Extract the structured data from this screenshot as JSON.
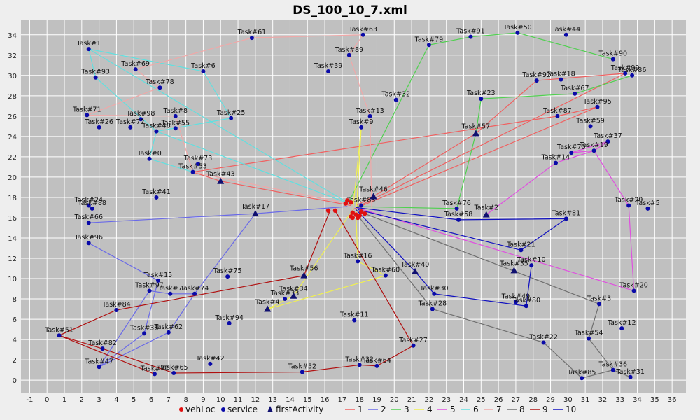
{
  "chart_data": {
    "type": "scatter",
    "title": "DS_100_10_7.xml",
    "xlabel": "",
    "ylabel": "",
    "xlim": [
      -1.5,
      36.8
    ],
    "ylim": [
      -1.3,
      35.5
    ],
    "x_ticks": [
      -1,
      0,
      1,
      2,
      3,
      4,
      5,
      6,
      7,
      8,
      9,
      10,
      11,
      12,
      13,
      14,
      15,
      16,
      17,
      18,
      19,
      20,
      21,
      22,
      23,
      24,
      25,
      26,
      27,
      28,
      29,
      30,
      31,
      32,
      33,
      34,
      35,
      36
    ],
    "y_ticks": [
      0,
      2,
      4,
      6,
      8,
      10,
      12,
      14,
      16,
      18,
      20,
      22,
      24,
      26,
      28,
      30,
      32,
      34
    ],
    "grid": true,
    "legend_position": "bottom",
    "colors": {
      "background": "#c0c0c0",
      "grid": "#ffffff",
      "vehLoc": "#e01010",
      "service": "#0a0aa8",
      "firstActivity": "#101070",
      "route_1": "#f06060",
      "route_2": "#6a6ae8",
      "route_3": "#50d050",
      "route_4": "#f0f050",
      "route_5": "#e050e0",
      "route_6": "#60e0e0",
      "route_7": "#f0a8a8",
      "route_8": "#707070",
      "route_9": "#b01010",
      "route_10": "#1010c0"
    },
    "legend": [
      {
        "label": "vehLoc",
        "kind": "dot",
        "color": "#e01010"
      },
      {
        "label": "service",
        "kind": "dot",
        "color": "#0a0aa8"
      },
      {
        "label": "firstActivity",
        "kind": "triangle",
        "color": "#101070"
      },
      {
        "label": "1",
        "kind": "line",
        "color": "#f06060"
      },
      {
        "label": "2",
        "kind": "line",
        "color": "#6a6ae8"
      },
      {
        "label": "3",
        "kind": "line",
        "color": "#50d050"
      },
      {
        "label": "4",
        "kind": "line",
        "color": "#f0f050"
      },
      {
        "label": "5",
        "kind": "line",
        "color": "#e050e0"
      },
      {
        "label": "6",
        "kind": "line",
        "color": "#60e0e0"
      },
      {
        "label": "7",
        "kind": "line",
        "color": "#f0a8a8"
      },
      {
        "label": "8",
        "kind": "line",
        "color": "#707070"
      },
      {
        "label": "9",
        "kind": "line",
        "color": "#b01010"
      },
      {
        "label": "10",
        "kind": "line",
        "color": "#1010c0"
      }
    ],
    "vehicle_locations": [
      [
        17.2,
        17.4
      ],
      [
        17.3,
        17.7
      ],
      [
        17.5,
        17.5
      ],
      [
        16.2,
        16.7
      ],
      [
        16.6,
        16.7
      ],
      [
        17.6,
        16.5
      ],
      [
        17.8,
        16.3
      ],
      [
        17.9,
        16.0
      ],
      [
        17.6,
        16.0
      ],
      [
        17.5,
        16.1
      ],
      [
        18.3,
        16.4
      ],
      [
        18.1,
        16.6
      ],
      [
        18.0,
        16.2
      ]
    ],
    "points": [
      {
        "label": "Task#1",
        "x": 2.4,
        "y": 32.6
      },
      {
        "label": "Task#93",
        "x": 2.8,
        "y": 29.8
      },
      {
        "label": "Task#69",
        "x": 5.1,
        "y": 30.6
      },
      {
        "label": "Task#6",
        "x": 9.0,
        "y": 30.4
      },
      {
        "label": "Task#78",
        "x": 6.5,
        "y": 28.8
      },
      {
        "label": "Task#71",
        "x": 2.3,
        "y": 26.1
      },
      {
        "label": "Task#98",
        "x": 5.4,
        "y": 25.7
      },
      {
        "label": "Task#8",
        "x": 7.4,
        "y": 26.0
      },
      {
        "label": "Task#25",
        "x": 10.6,
        "y": 25.8
      },
      {
        "label": "Task#26",
        "x": 3.0,
        "y": 24.9
      },
      {
        "label": "Task#72",
        "x": 4.8,
        "y": 24.9
      },
      {
        "label": "Task#48",
        "x": 6.3,
        "y": 24.5
      },
      {
        "label": "Task#55",
        "x": 7.4,
        "y": 24.8
      },
      {
        "label": "Task#0",
        "x": 5.9,
        "y": 21.8
      },
      {
        "label": "Task#73",
        "x": 8.7,
        "y": 21.3
      },
      {
        "label": "Task#53",
        "x": 8.4,
        "y": 20.5
      },
      {
        "label": "Task#41",
        "x": 6.3,
        "y": 18.0
      },
      {
        "label": "Task#24",
        "x": 2.4,
        "y": 17.2
      },
      {
        "label": "Task#88",
        "x": 2.6,
        "y": 16.9
      },
      {
        "label": "Task#66",
        "x": 2.4,
        "y": 15.5
      },
      {
        "label": "Task#96",
        "x": 2.4,
        "y": 13.5
      },
      {
        "label": "Task#15",
        "x": 6.4,
        "y": 9.8
      },
      {
        "label": "Task#97",
        "x": 5.9,
        "y": 8.8
      },
      {
        "label": "Task#7",
        "x": 7.1,
        "y": 8.5
      },
      {
        "label": "Task#74",
        "x": 8.5,
        "y": 8.5
      },
      {
        "label": "Task#75",
        "x": 10.4,
        "y": 10.2
      },
      {
        "label": "Task#84",
        "x": 4.0,
        "y": 6.9
      },
      {
        "label": "Task#38",
        "x": 5.6,
        "y": 4.6
      },
      {
        "label": "Task#62",
        "x": 7.0,
        "y": 4.7
      },
      {
        "label": "Task#94",
        "x": 10.5,
        "y": 5.6
      },
      {
        "label": "Task#51",
        "x": 0.7,
        "y": 4.4
      },
      {
        "label": "Task#82",
        "x": 3.2,
        "y": 3.1
      },
      {
        "label": "Task#47",
        "x": 3.0,
        "y": 1.3
      },
      {
        "label": "Task#42",
        "x": 9.4,
        "y": 1.6
      },
      {
        "label": "Task#77",
        "x": 6.2,
        "y": 0.6
      },
      {
        "label": "Task#65",
        "x": 7.3,
        "y": 0.7
      },
      {
        "label": "Task#61",
        "x": 11.8,
        "y": 33.7
      },
      {
        "label": "Task#63",
        "x": 18.2,
        "y": 34.0
      },
      {
        "label": "Task#89",
        "x": 17.4,
        "y": 32.0
      },
      {
        "label": "Task#39",
        "x": 16.2,
        "y": 30.4
      },
      {
        "label": "Task#32",
        "x": 20.1,
        "y": 27.6
      },
      {
        "label": "Task#13",
        "x": 18.6,
        "y": 26.0
      },
      {
        "label": "Task#9",
        "x": 18.1,
        "y": 24.9
      },
      {
        "label": "Task#83",
        "x": 18.1,
        "y": 17.2
      },
      {
        "label": "Task#16",
        "x": 17.9,
        "y": 11.7
      },
      {
        "label": "Task#60",
        "x": 19.5,
        "y": 10.3
      },
      {
        "label": "Task#11",
        "x": 17.7,
        "y": 5.9
      },
      {
        "label": "Task#33",
        "x": 13.7,
        "y": 8.0
      },
      {
        "label": "Task#52",
        "x": 14.7,
        "y": 0.8
      },
      {
        "label": "Task#32b",
        "x": 18.0,
        "y": 1.5
      },
      {
        "label": "Task#64",
        "x": 19.0,
        "y": 1.4
      },
      {
        "label": "Task#27",
        "x": 21.1,
        "y": 3.4
      },
      {
        "label": "Task#30",
        "x": 22.3,
        "y": 8.5
      },
      {
        "label": "Task#28",
        "x": 22.2,
        "y": 7.0
      },
      {
        "label": "Task#79",
        "x": 22.0,
        "y": 33.0
      },
      {
        "label": "Task#91",
        "x": 24.4,
        "y": 33.8
      },
      {
        "label": "Task#50",
        "x": 27.1,
        "y": 34.2
      },
      {
        "label": "Task#44",
        "x": 29.9,
        "y": 34.0
      },
      {
        "label": "Task#90",
        "x": 32.6,
        "y": 31.6
      },
      {
        "label": "Task#99",
        "x": 33.3,
        "y": 30.2
      },
      {
        "label": "Task#86",
        "x": 33.7,
        "y": 30.0
      },
      {
        "label": "Task#92",
        "x": 28.2,
        "y": 29.5
      },
      {
        "label": "Task#18",
        "x": 29.6,
        "y": 29.6
      },
      {
        "label": "Task#67",
        "x": 30.4,
        "y": 28.2
      },
      {
        "label": "Task#23",
        "x": 25.0,
        "y": 27.7
      },
      {
        "label": "Task#95",
        "x": 31.7,
        "y": 26.9
      },
      {
        "label": "Task#87",
        "x": 29.4,
        "y": 26.0
      },
      {
        "label": "Task#59",
        "x": 31.3,
        "y": 25.0
      },
      {
        "label": "Task#37",
        "x": 32.3,
        "y": 23.5
      },
      {
        "label": "Task#70",
        "x": 30.2,
        "y": 22.4
      },
      {
        "label": "Task#19",
        "x": 31.5,
        "y": 22.6
      },
      {
        "label": "Task#14",
        "x": 29.3,
        "y": 21.4
      },
      {
        "label": "Task#76",
        "x": 23.6,
        "y": 16.9
      },
      {
        "label": "Task#58",
        "x": 23.7,
        "y": 15.8
      },
      {
        "label": "Task#81",
        "x": 29.9,
        "y": 15.9
      },
      {
        "label": "Task#29",
        "x": 33.5,
        "y": 17.2
      },
      {
        "label": "Task#5",
        "x": 34.6,
        "y": 16.9
      },
      {
        "label": "Task#21",
        "x": 27.3,
        "y": 12.8
      },
      {
        "label": "Task#10",
        "x": 27.9,
        "y": 11.3
      },
      {
        "label": "Task#20",
        "x": 33.8,
        "y": 8.8
      },
      {
        "label": "Task#49",
        "x": 27.0,
        "y": 7.7
      },
      {
        "label": "Task#80",
        "x": 27.6,
        "y": 7.3
      },
      {
        "label": "Task#3",
        "x": 31.8,
        "y": 7.5
      },
      {
        "label": "Task#12",
        "x": 33.1,
        "y": 5.1
      },
      {
        "label": "Task#54",
        "x": 31.2,
        "y": 4.1
      },
      {
        "label": "Task#22",
        "x": 28.6,
        "y": 3.7
      },
      {
        "label": "Task#85",
        "x": 30.8,
        "y": 0.2
      },
      {
        "label": "Task#36",
        "x": 32.6,
        "y": 1.0
      },
      {
        "label": "Task#31",
        "x": 33.6,
        "y": 0.3
      }
    ],
    "first_activities": [
      {
        "label": "Task#43",
        "x": 10.0,
        "y": 19.6
      },
      {
        "label": "Task#17",
        "x": 12.0,
        "y": 16.4
      },
      {
        "label": "Task#46",
        "x": 18.8,
        "y": 18.1
      },
      {
        "label": "Task#57",
        "x": 24.7,
        "y": 24.3
      },
      {
        "label": "Task#2",
        "x": 25.3,
        "y": 16.3
      },
      {
        "label": "Task#35",
        "x": 26.9,
        "y": 10.8
      },
      {
        "label": "Task#40",
        "x": 21.2,
        "y": 10.7
      },
      {
        "label": "Task#56",
        "x": 14.8,
        "y": 10.3
      },
      {
        "label": "Task#34",
        "x": 14.2,
        "y": 8.3
      },
      {
        "label": "Task#4",
        "x": 12.7,
        "y": 7.0
      }
    ],
    "routes": [
      {
        "name": "1",
        "color": "#f06060",
        "points": [
          [
            17.5,
            17.2
          ],
          [
            10.0,
            19.6
          ],
          [
            8.4,
            20.5
          ],
          [
            29.4,
            26.0
          ],
          [
            31.7,
            26.9
          ],
          [
            17.6,
            16.8
          ]
        ]
      },
      {
        "name": "1b",
        "color": "#f06060",
        "points": [
          [
            17.8,
            17.2
          ],
          [
            18.8,
            18.1
          ],
          [
            24.7,
            24.3
          ],
          [
            28.2,
            29.5
          ],
          [
            33.3,
            30.2
          ],
          [
            17.8,
            17.0
          ]
        ]
      },
      {
        "name": "2",
        "color": "#6a6ae8",
        "points": [
          [
            17.3,
            17.1
          ],
          [
            12.0,
            16.4
          ],
          [
            2.4,
            15.5
          ]
        ]
      },
      {
        "name": "2b",
        "color": "#6a6ae8",
        "points": [
          [
            12.0,
            16.4
          ],
          [
            8.5,
            8.5
          ],
          [
            7.1,
            8.5
          ],
          [
            5.9,
            8.8
          ],
          [
            3.0,
            1.3
          ]
        ]
      },
      {
        "name": "2c",
        "color": "#6a6ae8",
        "points": [
          [
            2.4,
            13.5
          ],
          [
            6.4,
            9.8
          ],
          [
            5.6,
            4.6
          ],
          [
            3.0,
            1.3
          ],
          [
            7.0,
            4.7
          ],
          [
            8.5,
            8.5
          ]
        ]
      },
      {
        "name": "3",
        "color": "#50d050",
        "points": [
          [
            17.4,
            17.6
          ],
          [
            22.0,
            33.0
          ],
          [
            24.4,
            33.8
          ],
          [
            27.1,
            34.2
          ],
          [
            32.6,
            31.6
          ]
        ]
      },
      {
        "name": "3b",
        "color": "#50d050",
        "points": [
          [
            17.8,
            17.1
          ],
          [
            23.6,
            16.9
          ],
          [
            24.7,
            24.3
          ],
          [
            25.0,
            27.7
          ],
          [
            30.4,
            28.2
          ],
          [
            33.7,
            30.0
          ]
        ]
      },
      {
        "name": "4",
        "color": "#f0f050",
        "points": [
          [
            17.5,
            16.5
          ],
          [
            14.2,
            8.3
          ],
          [
            12.7,
            7.0
          ],
          [
            19.5,
            10.3
          ],
          [
            17.9,
            11.7
          ],
          [
            17.8,
            16.2
          ],
          [
            18.1,
            24.9
          ],
          [
            17.6,
            16.5
          ]
        ]
      },
      {
        "name": "5",
        "color": "#e050e0",
        "points": [
          [
            17.8,
            17.0
          ],
          [
            33.8,
            8.8
          ],
          [
            33.5,
            17.2
          ],
          [
            31.5,
            22.6
          ],
          [
            30.2,
            22.4
          ],
          [
            32.3,
            23.5
          ],
          [
            31.5,
            22.6
          ],
          [
            29.3,
            21.4
          ],
          [
            25.3,
            16.3
          ]
        ]
      },
      {
        "name": "6",
        "color": "#60e0e0",
        "points": [
          [
            17.4,
            17.4
          ],
          [
            2.4,
            32.6
          ],
          [
            9.0,
            30.4
          ],
          [
            10.6,
            25.8
          ],
          [
            6.3,
            24.5
          ],
          [
            5.9,
            21.8
          ],
          [
            8.4,
            20.5
          ]
        ]
      },
      {
        "name": "6b",
        "color": "#60e0e0",
        "points": [
          [
            17.4,
            17.4
          ],
          [
            6.3,
            24.5
          ],
          [
            2.8,
            29.8
          ],
          [
            2.4,
            32.6
          ]
        ]
      },
      {
        "name": "7",
        "color": "#f0a8a8",
        "points": [
          [
            17.6,
            17.3
          ],
          [
            8.4,
            20.5
          ],
          [
            7.4,
            26.0
          ],
          [
            2.3,
            26.1
          ],
          [
            6.5,
            28.8
          ],
          [
            5.1,
            30.6
          ],
          [
            11.8,
            33.7
          ],
          [
            18.2,
            34.0
          ],
          [
            17.4,
            32.0
          ],
          [
            18.6,
            26.0
          ],
          [
            18.7,
            17.0
          ]
        ]
      },
      {
        "name": "8",
        "color": "#707070",
        "points": [
          [
            17.9,
            16.2
          ],
          [
            22.2,
            7.0
          ],
          [
            28.6,
            3.7
          ],
          [
            30.8,
            0.2
          ],
          [
            32.6,
            1.0
          ],
          [
            33.6,
            0.3
          ]
        ]
      },
      {
        "name": "8b",
        "color": "#707070",
        "points": [
          [
            18.0,
            16.6
          ],
          [
            31.8,
            7.5
          ],
          [
            31.2,
            4.1
          ],
          [
            32.6,
            1.0
          ]
        ]
      },
      {
        "name": "9",
        "color": "#b01010",
        "points": [
          [
            16.3,
            16.7
          ],
          [
            14.8,
            10.3
          ],
          [
            4.0,
            6.9
          ],
          [
            0.7,
            4.4
          ],
          [
            3.2,
            3.1
          ],
          [
            7.3,
            0.7
          ],
          [
            14.7,
            0.8
          ],
          [
            18.0,
            1.5
          ],
          [
            19.0,
            1.4
          ],
          [
            21.1,
            3.4
          ],
          [
            16.6,
            16.7
          ]
        ]
      },
      {
        "name": "9b",
        "color": "#b01010",
        "points": [
          [
            0.7,
            4.4
          ],
          [
            6.2,
            0.6
          ]
        ]
      },
      {
        "name": "10",
        "color": "#1010c0",
        "points": [
          [
            17.8,
            17.0
          ],
          [
            23.7,
            15.8
          ],
          [
            29.9,
            15.9
          ],
          [
            27.3,
            12.8
          ],
          [
            17.9,
            16.8
          ]
        ]
      },
      {
        "name": "10b",
        "color": "#1010c0",
        "points": [
          [
            17.8,
            16.8
          ],
          [
            21.2,
            10.7
          ],
          [
            22.3,
            8.5
          ],
          [
            27.6,
            7.3
          ],
          [
            27.9,
            11.3
          ]
        ]
      }
    ]
  }
}
